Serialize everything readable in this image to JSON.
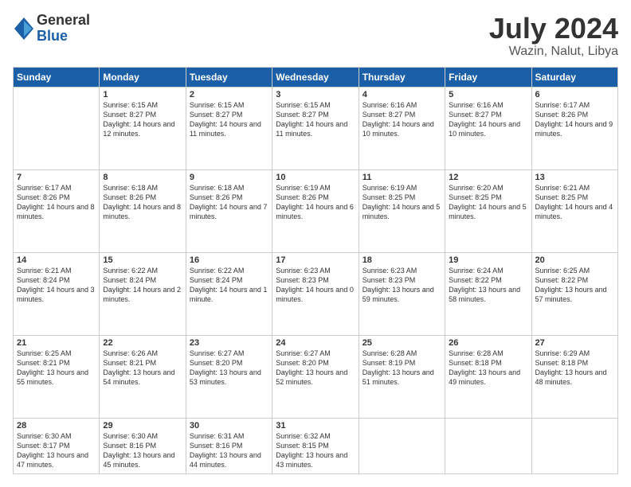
{
  "header": {
    "logo_general": "General",
    "logo_blue": "Blue",
    "month_title": "July 2024",
    "location": "Wazin, Nalut, Libya"
  },
  "days_of_week": [
    "Sunday",
    "Monday",
    "Tuesday",
    "Wednesday",
    "Thursday",
    "Friday",
    "Saturday"
  ],
  "weeks": [
    [
      {
        "day": "",
        "info": ""
      },
      {
        "day": "1",
        "info": "Sunrise: 6:15 AM\nSunset: 8:27 PM\nDaylight: 14 hours\nand 12 minutes."
      },
      {
        "day": "2",
        "info": "Sunrise: 6:15 AM\nSunset: 8:27 PM\nDaylight: 14 hours\nand 11 minutes."
      },
      {
        "day": "3",
        "info": "Sunrise: 6:15 AM\nSunset: 8:27 PM\nDaylight: 14 hours\nand 11 minutes."
      },
      {
        "day": "4",
        "info": "Sunrise: 6:16 AM\nSunset: 8:27 PM\nDaylight: 14 hours\nand 10 minutes."
      },
      {
        "day": "5",
        "info": "Sunrise: 6:16 AM\nSunset: 8:27 PM\nDaylight: 14 hours\nand 10 minutes."
      },
      {
        "day": "6",
        "info": "Sunrise: 6:17 AM\nSunset: 8:26 PM\nDaylight: 14 hours\nand 9 minutes."
      }
    ],
    [
      {
        "day": "7",
        "info": "Sunrise: 6:17 AM\nSunset: 8:26 PM\nDaylight: 14 hours\nand 8 minutes."
      },
      {
        "day": "8",
        "info": "Sunrise: 6:18 AM\nSunset: 8:26 PM\nDaylight: 14 hours\nand 8 minutes."
      },
      {
        "day": "9",
        "info": "Sunrise: 6:18 AM\nSunset: 8:26 PM\nDaylight: 14 hours\nand 7 minutes."
      },
      {
        "day": "10",
        "info": "Sunrise: 6:19 AM\nSunset: 8:26 PM\nDaylight: 14 hours\nand 6 minutes."
      },
      {
        "day": "11",
        "info": "Sunrise: 6:19 AM\nSunset: 8:25 PM\nDaylight: 14 hours\nand 5 minutes."
      },
      {
        "day": "12",
        "info": "Sunrise: 6:20 AM\nSunset: 8:25 PM\nDaylight: 14 hours\nand 5 minutes."
      },
      {
        "day": "13",
        "info": "Sunrise: 6:21 AM\nSunset: 8:25 PM\nDaylight: 14 hours\nand 4 minutes."
      }
    ],
    [
      {
        "day": "14",
        "info": "Sunrise: 6:21 AM\nSunset: 8:24 PM\nDaylight: 14 hours\nand 3 minutes."
      },
      {
        "day": "15",
        "info": "Sunrise: 6:22 AM\nSunset: 8:24 PM\nDaylight: 14 hours\nand 2 minutes."
      },
      {
        "day": "16",
        "info": "Sunrise: 6:22 AM\nSunset: 8:24 PM\nDaylight: 14 hours\nand 1 minute."
      },
      {
        "day": "17",
        "info": "Sunrise: 6:23 AM\nSunset: 8:23 PM\nDaylight: 14 hours\nand 0 minutes."
      },
      {
        "day": "18",
        "info": "Sunrise: 6:23 AM\nSunset: 8:23 PM\nDaylight: 13 hours\nand 59 minutes."
      },
      {
        "day": "19",
        "info": "Sunrise: 6:24 AM\nSunset: 8:22 PM\nDaylight: 13 hours\nand 58 minutes."
      },
      {
        "day": "20",
        "info": "Sunrise: 6:25 AM\nSunset: 8:22 PM\nDaylight: 13 hours\nand 57 minutes."
      }
    ],
    [
      {
        "day": "21",
        "info": "Sunrise: 6:25 AM\nSunset: 8:21 PM\nDaylight: 13 hours\nand 55 minutes."
      },
      {
        "day": "22",
        "info": "Sunrise: 6:26 AM\nSunset: 8:21 PM\nDaylight: 13 hours\nand 54 minutes."
      },
      {
        "day": "23",
        "info": "Sunrise: 6:27 AM\nSunset: 8:20 PM\nDaylight: 13 hours\nand 53 minutes."
      },
      {
        "day": "24",
        "info": "Sunrise: 6:27 AM\nSunset: 8:20 PM\nDaylight: 13 hours\nand 52 minutes."
      },
      {
        "day": "25",
        "info": "Sunrise: 6:28 AM\nSunset: 8:19 PM\nDaylight: 13 hours\nand 51 minutes."
      },
      {
        "day": "26",
        "info": "Sunrise: 6:28 AM\nSunset: 8:18 PM\nDaylight: 13 hours\nand 49 minutes."
      },
      {
        "day": "27",
        "info": "Sunrise: 6:29 AM\nSunset: 8:18 PM\nDaylight: 13 hours\nand 48 minutes."
      }
    ],
    [
      {
        "day": "28",
        "info": "Sunrise: 6:30 AM\nSunset: 8:17 PM\nDaylight: 13 hours\nand 47 minutes."
      },
      {
        "day": "29",
        "info": "Sunrise: 6:30 AM\nSunset: 8:16 PM\nDaylight: 13 hours\nand 45 minutes."
      },
      {
        "day": "30",
        "info": "Sunrise: 6:31 AM\nSunset: 8:16 PM\nDaylight: 13 hours\nand 44 minutes."
      },
      {
        "day": "31",
        "info": "Sunrise: 6:32 AM\nSunset: 8:15 PM\nDaylight: 13 hours\nand 43 minutes."
      },
      {
        "day": "",
        "info": ""
      },
      {
        "day": "",
        "info": ""
      },
      {
        "day": "",
        "info": ""
      }
    ]
  ]
}
